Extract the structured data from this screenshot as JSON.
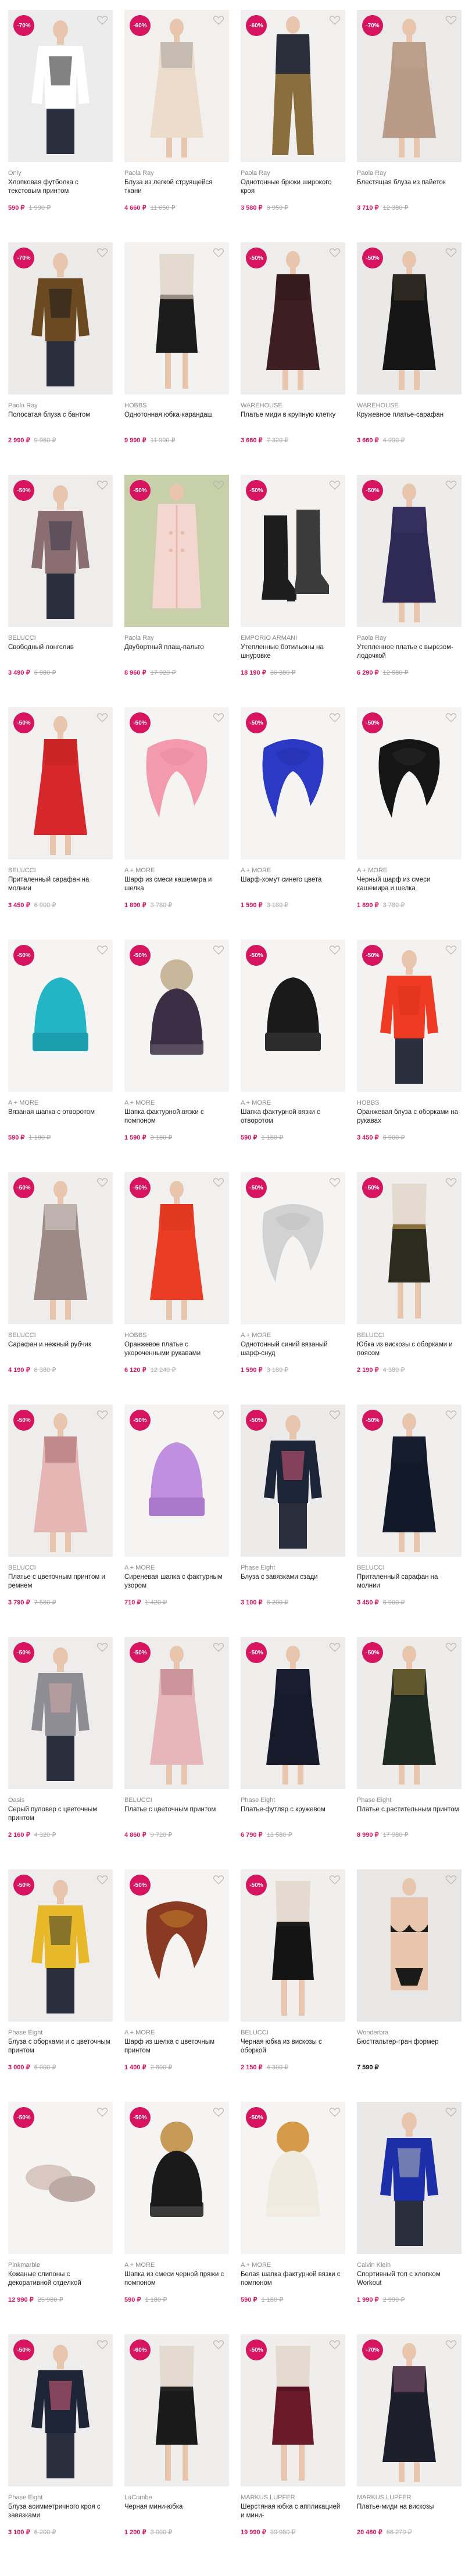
{
  "colors": {
    "accent": "#d6145f",
    "old_price": "#a8a8a8",
    "brand": "#8a8a8a"
  },
  "products": [
    {
      "badge": "-70%",
      "brand": "Only",
      "title": "Хлопковая футболка с текстовым принтом",
      "price": "590 ₽",
      "old_price": "1 990 ₽",
      "fill": "#ececec",
      "garment": "#ffffff",
      "garment2": "#1a1a1a",
      "shape": "top"
    },
    {
      "badge": "-60%",
      "brand": "Paola Ray",
      "title": "Блуза из легкой струящейся ткани",
      "price": "4 660 ₽",
      "old_price": "11 650 ₽",
      "fill": "#f2efec",
      "garment": "#ecdccc",
      "garment2": "#7d7d7d",
      "shape": "dress"
    },
    {
      "badge": "-60%",
      "brand": "Paola Ray",
      "title": "Однотонные брюки широкого кроя",
      "price": "3 580 ₽",
      "old_price": "8 950 ₽",
      "fill": "#f2f0ee",
      "garment": "#2b2e3b",
      "garment2": "#8a6e3e",
      "shape": "pants"
    },
    {
      "badge": "-70%",
      "brand": "Paola Ray",
      "title": "Блестящая блуза из пайеток",
      "price": "3 710 ₽",
      "old_price": "12 380 ₽",
      "fill": "#eceae8",
      "garment": "#b89a86",
      "garment2": "#c4a892",
      "shape": "dress"
    },
    {
      "badge": "-70%",
      "brand": "Paola Ray",
      "title": "Полосатая блуза с бантом",
      "price": "2 990 ₽",
      "old_price": "9 960 ₽",
      "fill": "#ecebe9",
      "garment": "#6b4a22",
      "garment2": "#1b1b1b",
      "shape": "top"
    },
    {
      "badge": "",
      "brand": "HOBBS",
      "title": "Однотонная юбка-карандаш",
      "price": "9 990 ₽",
      "old_price": "11 990 ₽",
      "fill": "#f4f2f0",
      "garment": "#1c1c1c",
      "garment2": "#e8d8c8",
      "shape": "skirt"
    },
    {
      "badge": "-50%",
      "brand": "WAREHOUSE",
      "title": "Платье миди в крупную клетку",
      "price": "3 660 ₽",
      "old_price": "7 320 ₽",
      "fill": "#efedeb",
      "garment": "#3d1f23",
      "garment2": "#2a1416",
      "shape": "dress"
    },
    {
      "badge": "-50%",
      "brand": "WAREHOUSE",
      "title": "Кружевное платье-сарафан",
      "price": "3 660 ₽",
      "old_price": "4 990 ₽",
      "fill": "#ebe9e7",
      "garment": "#161616",
      "garment2": "#5a4a3a",
      "shape": "dress"
    },
    {
      "badge": "-50%",
      "brand": "BELUCCI",
      "title": "Свободный лонгслив",
      "price": "3 490 ₽",
      "old_price": "6 980 ₽",
      "fill": "#efedeb",
      "garment": "#8b6e72",
      "garment2": "#3a3a4a",
      "shape": "top"
    },
    {
      "badge": "-50%",
      "brand": "Paola Ray",
      "title": "Двубортный плащ-пальто",
      "price": "8 960 ₽",
      "old_price": "17 920 ₽",
      "fill": "#c7d0a8",
      "garment": "#f4d6d0",
      "garment2": "#e9b9ae",
      "shape": "coat"
    },
    {
      "badge": "-50%",
      "brand": "EMPORIO ARMANI",
      "title": "Утепленные ботильоны на шнуровке",
      "price": "18 190 ₽",
      "old_price": "36 380 ₽",
      "fill": "#f4f2f0",
      "garment": "#1d1d1d",
      "garment2": "#3b3b3b",
      "shape": "boots"
    },
    {
      "badge": "-50%",
      "brand": "Paola Ray",
      "title": "Утепленное платье с вырезом-лодочкой",
      "price": "6 290 ₽",
      "old_price": "12 580 ₽",
      "fill": "#eeecea",
      "garment": "#2e2a55",
      "garment2": "#3e3a6a",
      "shape": "dress"
    },
    {
      "badge": "-50%",
      "brand": "BELUCCI",
      "title": "Приталенный сарафан на молнии",
      "price": "3 450 ₽",
      "old_price": "6 900 ₽",
      "fill": "#f2f0ee",
      "garment": "#d6272a",
      "garment2": "#b81f22",
      "shape": "dress"
    },
    {
      "badge": "-50%",
      "brand": "A + MORE",
      "title": "Шарф из смеси кашемира и шелка",
      "price": "1 890 ₽",
      "old_price": "3 780 ₽",
      "fill": "#f6f4f2",
      "garment": "#f39aae",
      "garment2": "#e98aa0",
      "shape": "scarf"
    },
    {
      "badge": "-50%",
      "brand": "A + MORE",
      "title": "Шарф-хомут синего цвета",
      "price": "1 590 ₽",
      "old_price": "3 180 ₽",
      "fill": "#f6f4f2",
      "garment": "#2c39c4",
      "garment2": "#2230aa",
      "shape": "scarf"
    },
    {
      "badge": "-50%",
      "brand": "A + MORE",
      "title": "Черный шарф из смеси кашемира и шелка",
      "price": "1 890 ₽",
      "old_price": "3 780 ₽",
      "fill": "#f6f4f2",
      "garment": "#151515",
      "garment2": "#2a2a2a",
      "shape": "scarf"
    },
    {
      "badge": "-50%",
      "brand": "A + MORE",
      "title": "Вязаная шапка с отворотом",
      "price": "590 ₽",
      "old_price": "1 180 ₽",
      "fill": "#f6f4f2",
      "garment": "#22b5c6",
      "garment2": "#1c9eae",
      "shape": "hat"
    },
    {
      "badge": "-50%",
      "brand": "A + MORE",
      "title": "Шапка фактурной вязки с помпоном",
      "price": "1 590 ₽",
      "old_price": "3 180 ₽",
      "fill": "#f6f4f2",
      "garment": "#3c2f45",
      "garment2": "#c9b79c",
      "shape": "pomhat"
    },
    {
      "badge": "-50%",
      "brand": "A + MORE",
      "title": "Шапка фактурной вязки с отворотом",
      "price": "590 ₽",
      "old_price": "1 180 ₽",
      "fill": "#f6f4f2",
      "garment": "#1a1a1a",
      "garment2": "#2c2c2c",
      "shape": "hat"
    },
    {
      "badge": "-50%",
      "brand": "HOBBS",
      "title": "Оранжевая блуза с оборками на рукавах",
      "price": "3 450 ₽",
      "old_price": "6 900 ₽",
      "fill": "#f4f2f0",
      "garment": "#ef3b24",
      "garment2": "#d9321c",
      "shape": "top"
    },
    {
      "badge": "-50%",
      "brand": "BELUCCI",
      "title": "Сарафан и нежный рубчик",
      "price": "4 190 ₽",
      "old_price": "8 380 ₽",
      "fill": "#f0eeec",
      "garment": "#9d8a86",
      "garment2": "#ffffff",
      "shape": "dress"
    },
    {
      "badge": "-50%",
      "brand": "HOBBS",
      "title": "Оранжевое платье с укороченными рукавами",
      "price": "6 120 ₽",
      "old_price": "12 240 ₽",
      "fill": "#f2f0ee",
      "garment": "#ea3d24",
      "garment2": "#d2331c",
      "shape": "dress"
    },
    {
      "badge": "-50%",
      "brand": "A + MORE",
      "title": "Однотонный синий вязаный шарф-снуд",
      "price": "1 590 ₽",
      "old_price": "3 180 ₽",
      "fill": "#f6f4f2",
      "garment": "#d2d2d2",
      "garment2": "#bdbdbd",
      "shape": "scarf"
    },
    {
      "badge": "-50%",
      "brand": "BELUCCI",
      "title": "Юбка из вискозы с оборками и поясом",
      "price": "2 190 ₽",
      "old_price": "4 380 ₽",
      "fill": "#f0eeec",
      "garment": "#2b2b1e",
      "garment2": "#c99e4c",
      "shape": "skirt"
    },
    {
      "badge": "-50%",
      "brand": "BELUCCI",
      "title": "Платье с цветочным принтом и ремнем",
      "price": "3 790 ₽",
      "old_price": "7 580 ₽",
      "fill": "#efedeb",
      "garment": "#e5b6b3",
      "garment2": "#7a3a44",
      "shape": "dress"
    },
    {
      "badge": "-50%",
      "brand": "A + MORE",
      "title": "Сиреневая шапка с фактурным узором",
      "price": "710 ₽",
      "old_price": "1 420 ₽",
      "fill": "#f6f4f2",
      "garment": "#c08fe0",
      "garment2": "#aa79cc",
      "shape": "hat"
    },
    {
      "badge": "-50%",
      "brand": "Phase Eight",
      "title": "Блуза с завязками сзади",
      "price": "3 100 ₽",
      "old_price": "6 200 ₽",
      "fill": "#ecebe9",
      "garment": "#1c2437",
      "garment2": "#d95a78",
      "shape": "top"
    },
    {
      "badge": "-50%",
      "brand": "BELUCCI",
      "title": "Приталенный сарафан на молнии",
      "price": "3 450 ₽",
      "old_price": "6 900 ₽",
      "fill": "#f1efed",
      "garment": "#121a2a",
      "garment2": "#1c2536",
      "shape": "dress"
    },
    {
      "badge": "-50%",
      "brand": "Oasis",
      "title": "Серый пуловер с цветочным принтом",
      "price": "2 160 ₽",
      "old_price": "4 320 ₽",
      "fill": "#efedeb",
      "garment": "#8d8d93",
      "garment2": "#d6a7a7",
      "shape": "top"
    },
    {
      "badge": "-50%",
      "brand": "BELUCCI",
      "title": "Платье с цветочным принтом",
      "price": "4 860 ₽",
      "old_price": "9 720 ₽",
      "fill": "#efedeb",
      "garment": "#e7b6ba",
      "garment2": "#9a5a6a",
      "shape": "dress"
    },
    {
      "badge": "-50%",
      "brand": "Phase Eight",
      "title": "Платье-футляр с кружевом",
      "price": "6 790 ₽",
      "old_price": "13 580 ₽",
      "fill": "#efedeb",
      "garment": "#161a2a",
      "garment2": "#20253a",
      "shape": "dress"
    },
    {
      "badge": "-50%",
      "brand": "Phase Eight",
      "title": "Платье с растительным принтом",
      "price": "8 990 ₽",
      "old_price": "17 980 ₽",
      "fill": "#eeecea",
      "garment": "#1f2a22",
      "garment2": "#e0b04a",
      "shape": "dress"
    },
    {
      "badge": "-50%",
      "brand": "Phase Eight",
      "title": "Блуза с оборками и с цветочным принтом",
      "price": "3 000 ₽",
      "old_price": "6 000 ₽",
      "fill": "#efedeb",
      "garment": "#e7b82a",
      "garment2": "#3a3a2a",
      "shape": "top"
    },
    {
      "badge": "-50%",
      "brand": "A + MORE",
      "title": "Шарф из шелка с цветочным принтом",
      "price": "1 400 ₽",
      "old_price": "2 800 ₽",
      "fill": "#f6f4f2",
      "garment": "#8a3a22",
      "garment2": "#c7882a",
      "shape": "scarf"
    },
    {
      "badge": "-50%",
      "brand": "BELUCCI",
      "title": "Черная юбка из вискозы с оборкой",
      "price": "2 150 ₽",
      "old_price": "4 300 ₽",
      "fill": "#f1efed",
      "garment": "#141414",
      "garment2": "#222222",
      "shape": "skirt"
    },
    {
      "badge": "",
      "brand": "Wonderbra",
      "title": "Бюстгальтер-гран формер",
      "price": "7 590 ₽",
      "old_price": "",
      "fill": "#e9e7e5",
      "garment": "#1a1a1a",
      "garment2": "#d7b8a8",
      "shape": "bra"
    },
    {
      "badge": "-50%",
      "brand": "Pinkmarble",
      "title": "Кожаные слипоны с декоративной отделкой",
      "price": "12 990 ₽",
      "old_price": "25 980 ₽",
      "fill": "#f6f4f2",
      "garment": "#d9c8c2",
      "garment2": "#bcaaa4",
      "shape": "slippers"
    },
    {
      "badge": "-50%",
      "brand": "A + MORE",
      "title": "Шапка из смеси черной пряжи с помпоном",
      "price": "590 ₽",
      "old_price": "1 180 ₽",
      "fill": "#f6f4f2",
      "garment": "#1a1a1a",
      "garment2": "#c69b5a",
      "shape": "pomhat"
    },
    {
      "badge": "-50%",
      "brand": "A + MORE",
      "title": "Белая шапка фактурной вязки с помпоном",
      "price": "590 ₽",
      "old_price": "1 180 ₽",
      "fill": "#f6f4f2",
      "garment": "#f0ebdf",
      "garment2": "#d49a48",
      "shape": "pomhat"
    },
    {
      "badge": "",
      "brand": "Calvin Klein",
      "title": "Спортивный топ с хлопком Workout",
      "price": "1 990 ₽",
      "old_price": "2 990 ₽",
      "fill": "#ebe9e7",
      "garment": "#1c2ea8",
      "garment2": "#bcbcbc",
      "shape": "top"
    },
    {
      "badge": "-50%",
      "brand": "Phase Eight",
      "title": "Блуза асимметричного кроя с завязками",
      "price": "3 100 ₽",
      "old_price": "6 200 ₽",
      "fill": "#efedeb",
      "garment": "#1d2436",
      "garment2": "#d9607e",
      "shape": "top"
    },
    {
      "badge": "-60%",
      "brand": "LaCombe",
      "title": "Черная мини-юбка",
      "price": "1 200 ₽",
      "old_price": "3 000 ₽",
      "fill": "#f0eeec",
      "garment": "#1a1a1a",
      "garment2": "#2a2a2a",
      "shape": "skirt"
    },
    {
      "badge": "-50%",
      "brand": "MARKUS LUPFER",
      "title": "Шерстяная юбка с аппликацией и мини-",
      "price": "19 990 ₽",
      "old_price": "39 980 ₽",
      "fill": "#f0eeec",
      "garment": "#6b1a2a",
      "garment2": "#4a0f1c",
      "shape": "skirt"
    },
    {
      "badge": "-70%",
      "brand": "MARKUS LUPFER",
      "title": "Платье-миди на вискозы",
      "price": "20 480 ₽",
      "old_price": "68 270 ₽",
      "fill": "#f0eeec",
      "garment": "#1c1e2c",
      "garment2": "#cf7aa0",
      "shape": "dress"
    }
  ]
}
